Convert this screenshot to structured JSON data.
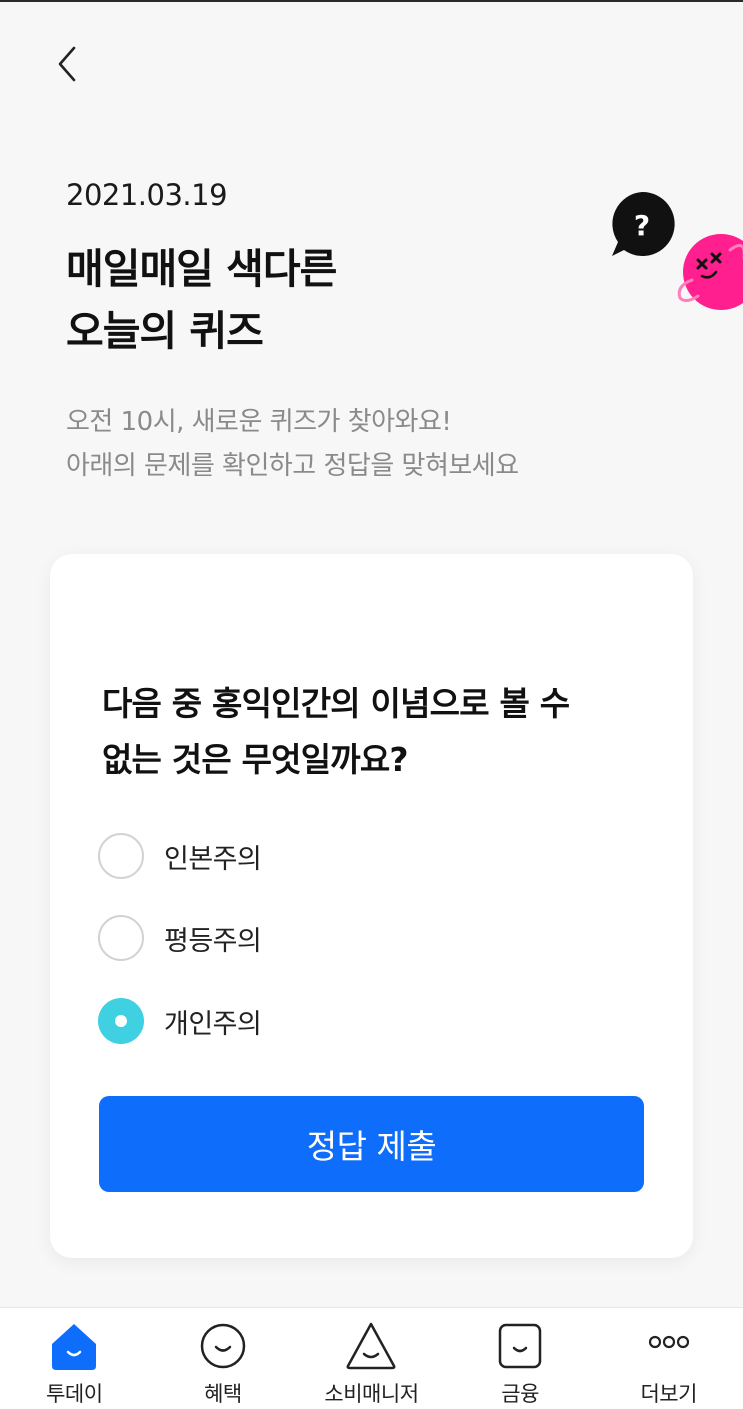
{
  "header": {
    "date": "2021.03.19",
    "title_line1": "매일매일 색다른",
    "title_line2": "오늘의 퀴즈"
  },
  "intro": {
    "line1": "오전 10시, 새로운 퀴즈가 찾아와요!",
    "line2": "아래의 문제를 확인하고 정답을 맞혀보세요"
  },
  "mascot": {
    "bubble_text": "?",
    "icon": "question-mascot"
  },
  "quiz": {
    "question_line1": "다음 중 홍익인간의 이념으로 볼 수",
    "question_line2": "없는 것은 무엇일까요?",
    "options": [
      {
        "label": "인본주의",
        "selected": false
      },
      {
        "label": "평등주의",
        "selected": false
      },
      {
        "label": "개인주의",
        "selected": true
      }
    ],
    "submit_label": "정답 제출"
  },
  "bottom_nav": {
    "items": [
      {
        "label": "투데이",
        "icon": "home-icon",
        "active": true
      },
      {
        "label": "혜택",
        "icon": "smile-circle-icon",
        "active": false
      },
      {
        "label": "소비매니저",
        "icon": "smile-triangle-icon",
        "active": false
      },
      {
        "label": "금융",
        "icon": "smile-square-icon",
        "active": false
      },
      {
        "label": "더보기",
        "icon": "more-dots-icon",
        "active": false
      }
    ]
  },
  "colors": {
    "accent_blue": "#0f6dfb",
    "radio_selected": "#3fd0e2",
    "mascot_pink": "#ff1f8e"
  }
}
